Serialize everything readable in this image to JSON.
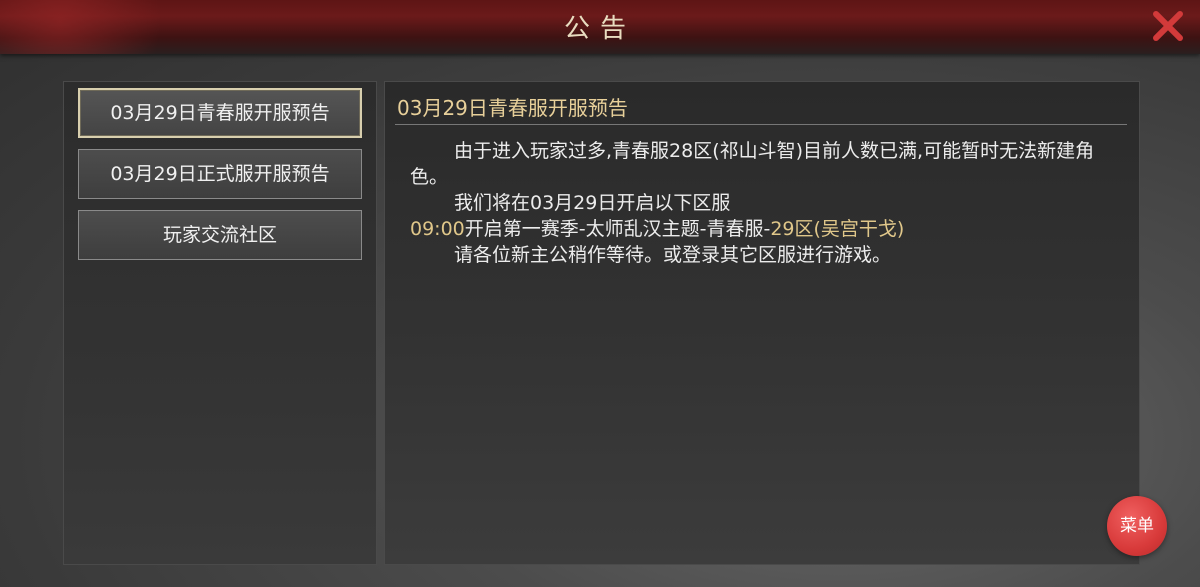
{
  "header": {
    "title": "公告"
  },
  "icons": {
    "close": "close-icon"
  },
  "sidebar": {
    "items": [
      {
        "label": "03月29日青春服开服预告",
        "active": true
      },
      {
        "label": "03月29日正式服开服预告",
        "active": false
      },
      {
        "label": "玩家交流社区",
        "active": false
      }
    ]
  },
  "content": {
    "title": "03月29日青春服开服预告",
    "line1": "由于进入玩家过多,青春服28区(祁山斗智)目前人数已满,可能暂时无法新建角色。",
    "line2": "我们将在03月29日开启以下区服",
    "line3_time": "09:00",
    "line3_mid": "开启第一赛季-太师乱汉主题-青春服-",
    "line3_server": "29区(吴宫干戈)",
    "line4": "请各位新主公稍作等待。或登录其它区服进行游戏。"
  },
  "menu_button": {
    "label": "菜单"
  },
  "colors": {
    "accent_gold": "#e0c78a",
    "title_red": "#6b1a1a",
    "menu_red": "#d83a3a"
  }
}
